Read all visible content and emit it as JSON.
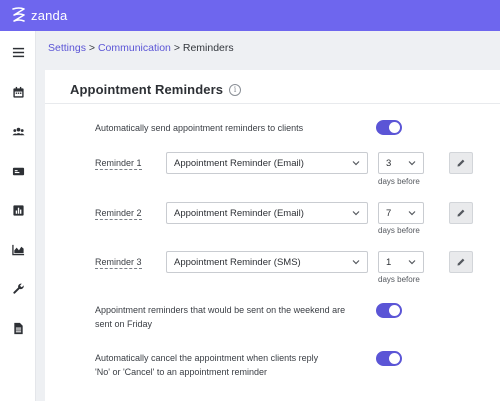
{
  "app": {
    "logo_text": "zanda"
  },
  "sidebar": {
    "items": [
      {
        "icon": "menu-icon"
      },
      {
        "icon": "calendar-icon"
      },
      {
        "icon": "users-icon"
      },
      {
        "icon": "id-card-icon"
      },
      {
        "icon": "report-icon"
      },
      {
        "icon": "chart-icon"
      },
      {
        "icon": "wrench-icon"
      },
      {
        "icon": "document-icon"
      }
    ]
  },
  "breadcrumb": {
    "items": [
      "Settings",
      "Communication",
      "Reminders"
    ],
    "separator": ">"
  },
  "panel": {
    "title": "Appointment Reminders",
    "info_glyph": "i"
  },
  "auto_send": {
    "label": "Automatically send appointment reminders to clients",
    "enabled": true
  },
  "reminders": [
    {
      "label": "Reminder 1",
      "template": "Appointment Reminder (Email)",
      "days": "3",
      "days_suffix": "days before"
    },
    {
      "label": "Reminder 2",
      "template": "Appointment Reminder (Email)",
      "days": "7",
      "days_suffix": "days before"
    },
    {
      "label": "Reminder 3",
      "template": "Appointment Reminder (SMS)",
      "days": "1",
      "days_suffix": "days before"
    }
  ],
  "weekend": {
    "label_line1": "Appointment reminders that would be sent on the weekend are",
    "label_line2": "sent on Friday",
    "enabled": true
  },
  "auto_cancel": {
    "label_line1": "Automatically cancel the appointment when clients reply",
    "label_line2": "'No' or 'Cancel' to an appointment reminder",
    "enabled": true
  },
  "colors": {
    "brand": "#6e66ee",
    "link": "#5b55d6",
    "toggle_on": "#5b55d6"
  }
}
